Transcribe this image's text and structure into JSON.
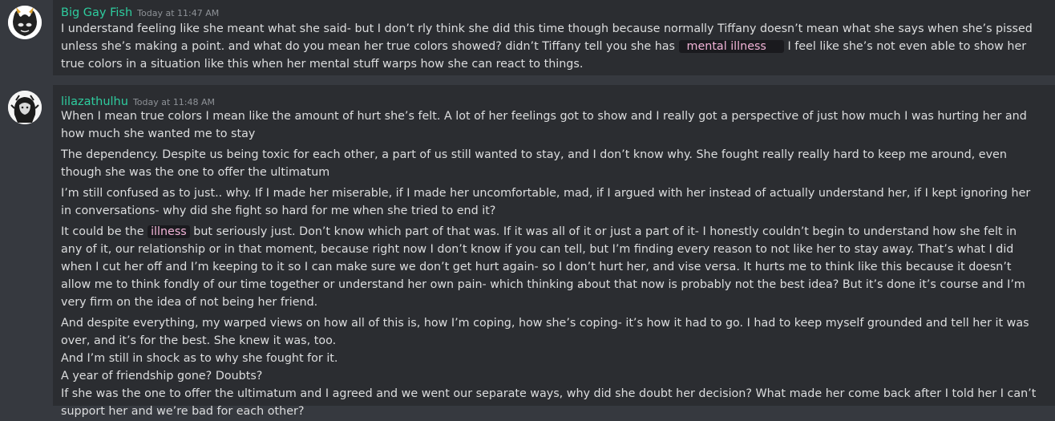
{
  "messages": [
    {
      "username": "Big Gay Fish",
      "timestamp": "Today at 11:47 AM",
      "text_pre": "I understand feeling like she meant what she said- but I don’t rly think she did this time though because normally Tiffany doesn’t mean what she says when she’s pissed unless she’s making a point. and what do you mean her true colors showed? didn’t Tiffany tell you she has",
      "spoiler": "mental illness",
      "text_post": "I feel like she’s not even able to show her true colors in a situation like this when her mental stuff warps how she can react to things."
    },
    {
      "username": "lilazathulhu",
      "timestamp": "Today at 11:48 AM",
      "p1": "When I mean true colors I mean like the amount of hurt she’s felt. A lot of her feelings got to show and I really got a perspective of just how much I was hurting her and how much she wanted me to stay",
      "p2": "The dependency. Despite us being toxic for each other, a part of us still wanted to stay, and I don’t know why. She fought really really hard to keep me around, even though she was the one to offer the ultimatum",
      "p3": "I’m still confused as to just.. why. If I made her miserable, if I made her uncomfortable, mad, if I argued with her instead of actually understand her, if I kept ignoring her in conversations- why did she fight so hard for me when she tried to end it?",
      "p4_pre": "It could be the",
      "p4_spoiler": "illness",
      "p4_post": "but seriously just. Don’t know which part of that was. If it was all of it or just a part of it- I honestly couldn’t begin to understand how she felt in any of it, our relationship or in that moment, because right now I don’t know if you can tell, but I’m finding every reason to not like her to stay away. That’s what I did when I cut her off and I’m keeping to it so I can make sure we don’t get hurt again- so I don’t hurt her, and vise versa. It hurts me to think like this because it doesn’t allow me to think fondly of our time together or understand her own pain- which thinking about that now is probably not the best idea? But it’s done it’s course and I’m very firm on the idea of not being her friend.",
      "p5": "And despite everything, my warped views on how all of this is, how I’m coping, how she’s coping- it’s how it had to go. I had to keep myself grounded and tell her it was over, and it’s for the best. She knew it was, too.",
      "p6": "And I’m still in shock as to why she fought for it.",
      "p7": "A year of friendship gone? Doubts?",
      "p8": "If she was the one to offer the ultimatum and I agreed and we went our separate ways, why did she doubt her decision? What made her come back after I told her I can’t support her and we’re bad for each other?"
    }
  ]
}
